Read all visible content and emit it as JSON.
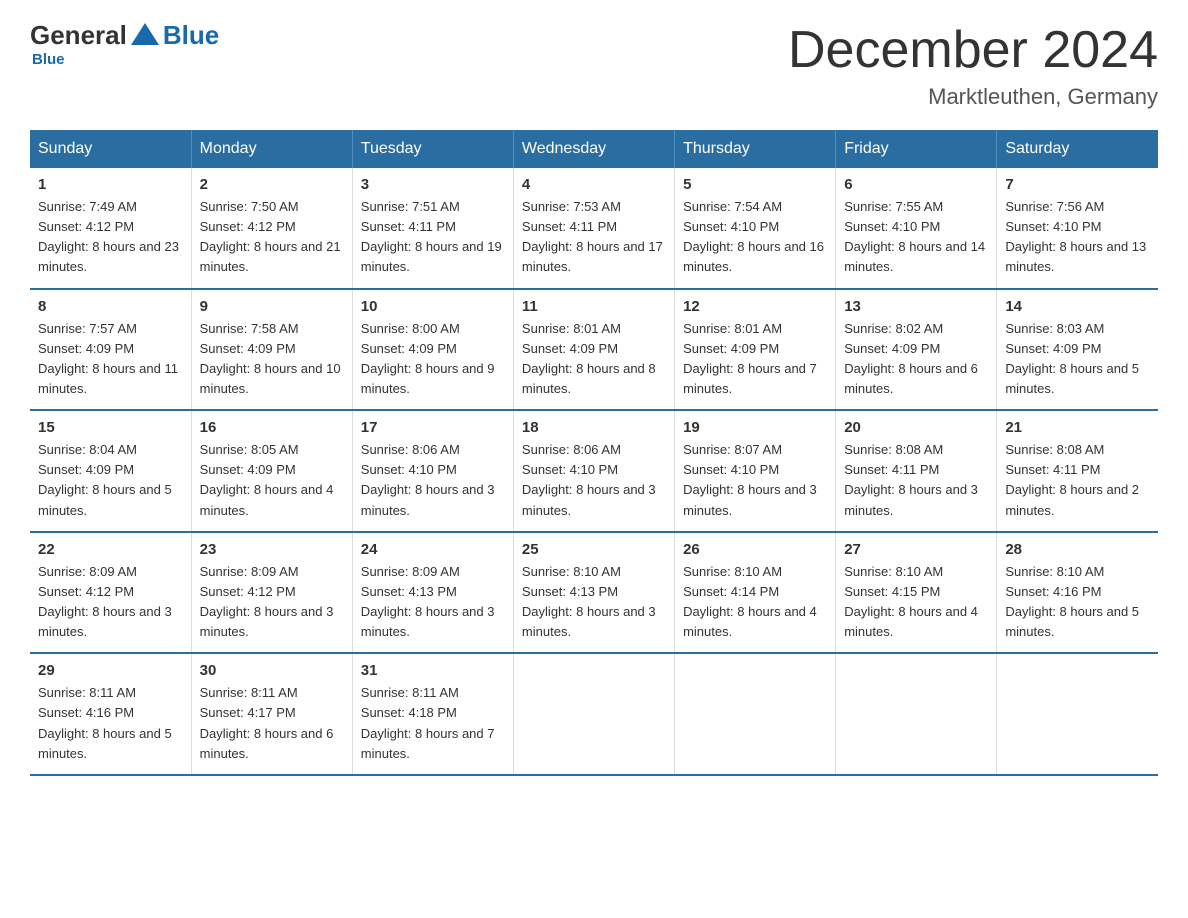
{
  "logo": {
    "general": "General",
    "blue": "Blue",
    "tagline": "Blue"
  },
  "title": {
    "month": "December 2024",
    "location": "Marktleuthen, Germany"
  },
  "days_of_week": [
    "Sunday",
    "Monday",
    "Tuesday",
    "Wednesday",
    "Thursday",
    "Friday",
    "Saturday"
  ],
  "weeks": [
    [
      {
        "day": "1",
        "sunrise": "7:49 AM",
        "sunset": "4:12 PM",
        "daylight": "8 hours and 23 minutes."
      },
      {
        "day": "2",
        "sunrise": "7:50 AM",
        "sunset": "4:12 PM",
        "daylight": "8 hours and 21 minutes."
      },
      {
        "day": "3",
        "sunrise": "7:51 AM",
        "sunset": "4:11 PM",
        "daylight": "8 hours and 19 minutes."
      },
      {
        "day": "4",
        "sunrise": "7:53 AM",
        "sunset": "4:11 PM",
        "daylight": "8 hours and 17 minutes."
      },
      {
        "day": "5",
        "sunrise": "7:54 AM",
        "sunset": "4:10 PM",
        "daylight": "8 hours and 16 minutes."
      },
      {
        "day": "6",
        "sunrise": "7:55 AM",
        "sunset": "4:10 PM",
        "daylight": "8 hours and 14 minutes."
      },
      {
        "day": "7",
        "sunrise": "7:56 AM",
        "sunset": "4:10 PM",
        "daylight": "8 hours and 13 minutes."
      }
    ],
    [
      {
        "day": "8",
        "sunrise": "7:57 AM",
        "sunset": "4:09 PM",
        "daylight": "8 hours and 11 minutes."
      },
      {
        "day": "9",
        "sunrise": "7:58 AM",
        "sunset": "4:09 PM",
        "daylight": "8 hours and 10 minutes."
      },
      {
        "day": "10",
        "sunrise": "8:00 AM",
        "sunset": "4:09 PM",
        "daylight": "8 hours and 9 minutes."
      },
      {
        "day": "11",
        "sunrise": "8:01 AM",
        "sunset": "4:09 PM",
        "daylight": "8 hours and 8 minutes."
      },
      {
        "day": "12",
        "sunrise": "8:01 AM",
        "sunset": "4:09 PM",
        "daylight": "8 hours and 7 minutes."
      },
      {
        "day": "13",
        "sunrise": "8:02 AM",
        "sunset": "4:09 PM",
        "daylight": "8 hours and 6 minutes."
      },
      {
        "day": "14",
        "sunrise": "8:03 AM",
        "sunset": "4:09 PM",
        "daylight": "8 hours and 5 minutes."
      }
    ],
    [
      {
        "day": "15",
        "sunrise": "8:04 AM",
        "sunset": "4:09 PM",
        "daylight": "8 hours and 5 minutes."
      },
      {
        "day": "16",
        "sunrise": "8:05 AM",
        "sunset": "4:09 PM",
        "daylight": "8 hours and 4 minutes."
      },
      {
        "day": "17",
        "sunrise": "8:06 AM",
        "sunset": "4:10 PM",
        "daylight": "8 hours and 3 minutes."
      },
      {
        "day": "18",
        "sunrise": "8:06 AM",
        "sunset": "4:10 PM",
        "daylight": "8 hours and 3 minutes."
      },
      {
        "day": "19",
        "sunrise": "8:07 AM",
        "sunset": "4:10 PM",
        "daylight": "8 hours and 3 minutes."
      },
      {
        "day": "20",
        "sunrise": "8:08 AM",
        "sunset": "4:11 PM",
        "daylight": "8 hours and 3 minutes."
      },
      {
        "day": "21",
        "sunrise": "8:08 AM",
        "sunset": "4:11 PM",
        "daylight": "8 hours and 2 minutes."
      }
    ],
    [
      {
        "day": "22",
        "sunrise": "8:09 AM",
        "sunset": "4:12 PM",
        "daylight": "8 hours and 3 minutes."
      },
      {
        "day": "23",
        "sunrise": "8:09 AM",
        "sunset": "4:12 PM",
        "daylight": "8 hours and 3 minutes."
      },
      {
        "day": "24",
        "sunrise": "8:09 AM",
        "sunset": "4:13 PM",
        "daylight": "8 hours and 3 minutes."
      },
      {
        "day": "25",
        "sunrise": "8:10 AM",
        "sunset": "4:13 PM",
        "daylight": "8 hours and 3 minutes."
      },
      {
        "day": "26",
        "sunrise": "8:10 AM",
        "sunset": "4:14 PM",
        "daylight": "8 hours and 4 minutes."
      },
      {
        "day": "27",
        "sunrise": "8:10 AM",
        "sunset": "4:15 PM",
        "daylight": "8 hours and 4 minutes."
      },
      {
        "day": "28",
        "sunrise": "8:10 AM",
        "sunset": "4:16 PM",
        "daylight": "8 hours and 5 minutes."
      }
    ],
    [
      {
        "day": "29",
        "sunrise": "8:11 AM",
        "sunset": "4:16 PM",
        "daylight": "8 hours and 5 minutes."
      },
      {
        "day": "30",
        "sunrise": "8:11 AM",
        "sunset": "4:17 PM",
        "daylight": "8 hours and 6 minutes."
      },
      {
        "day": "31",
        "sunrise": "8:11 AM",
        "sunset": "4:18 PM",
        "daylight": "8 hours and 7 minutes."
      },
      null,
      null,
      null,
      null
    ]
  ]
}
